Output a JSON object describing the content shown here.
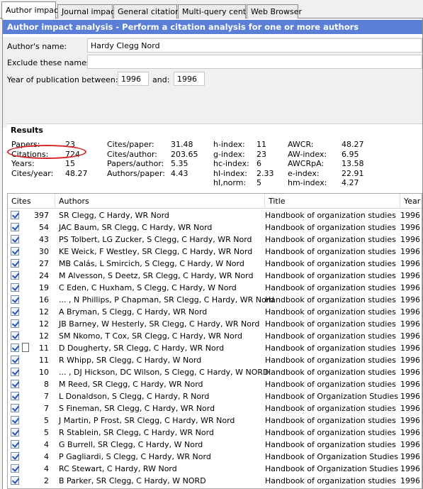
{
  "tabs": [
    "Author impact",
    "Journal impact",
    "General citations",
    "Multi-query center",
    "Web Browser"
  ],
  "header": "Author impact analysis - Perform a citation analysis for one or more authors",
  "form": {
    "author_label": "Author's name:",
    "author_value": "Hardy Clegg Nord",
    "exclude_label": "Exclude these names:",
    "exclude_value": "",
    "year_label": "Year of publication between:",
    "year_from": "1996",
    "and_label": "and:",
    "year_to": "1996"
  },
  "results": {
    "title": "Results",
    "col1": [
      [
        "Papers:",
        "23"
      ],
      [
        "Citations:",
        "724"
      ],
      [
        "Years:",
        "15"
      ],
      [
        "Cites/year:",
        "48.27"
      ]
    ],
    "col2": [
      [
        "Cites/paper:",
        "31.48"
      ],
      [
        "Cites/author:",
        "203.65"
      ],
      [
        "Papers/author:",
        "5.35"
      ],
      [
        "Authors/paper:",
        "4.43"
      ]
    ],
    "col3": [
      [
        "h-index:",
        "11"
      ],
      [
        "g-index:",
        "23"
      ],
      [
        "hc-index:",
        "6"
      ],
      [
        "hI-index:",
        "2.33"
      ],
      [
        "hI,norm:",
        "5"
      ]
    ],
    "col4": [
      [
        "AWCR:",
        "48.27"
      ],
      [
        "AW-index:",
        "6.95"
      ],
      [
        "AWCRpA:",
        "13.58"
      ],
      [
        "e-index:",
        "22.91"
      ],
      [
        "hm-index:",
        "4.27"
      ]
    ],
    "highlight_color": "#d4262b"
  },
  "table": {
    "headers": [
      "Cites",
      "Authors",
      "Title",
      "Year"
    ],
    "rows": [
      {
        "cites": "397",
        "authors": "SR Clegg, C Hardy, WR Nord",
        "title": "Handbook of organization studies",
        "year": "1996"
      },
      {
        "cites": "54",
        "authors": "JAC Baum, SR Clegg, C Hardy, WR Nord",
        "title": "Handbook of organization studies",
        "year": "1996"
      },
      {
        "cites": "43",
        "authors": "PS Tolbert, LG Zucker, S Clegg, C Hardy, WR Nord",
        "title": "Handbook of organization studies",
        "year": "1996"
      },
      {
        "cites": "30",
        "authors": "KE Weick, F Westley, SR Clegg, C Hardy, WR Nord",
        "title": "Handbook of organization studies",
        "year": "1996"
      },
      {
        "cites": "27",
        "authors": "MB Calás, L Smircich, S Clegg, C Hardy, W Nord",
        "title": "Handbook of organization studies",
        "year": "1996"
      },
      {
        "cites": "24",
        "authors": "M Alvesson, S Deetz, SR Clegg, C Hardy, WR Nord",
        "title": "Handbook of organization studies",
        "year": "1996"
      },
      {
        "cites": "19",
        "authors": "C Eden, C Huxham, S Clegg, C Hardy, W Nord",
        "title": "Handbook of organization studies",
        "year": "1996"
      },
      {
        "cites": "16",
        "authors": "... , N Phillips, P Chapman, SR Clegg, C Hardy, WR Nord",
        "title": "Handbook of organization studies",
        "year": "1996"
      },
      {
        "cites": "12",
        "authors": "A Bryman, S Clegg, C Hardy, WR Nord",
        "title": "Handbook of organization studies",
        "year": "1996"
      },
      {
        "cites": "12",
        "authors": "JB Barney, W Hesterly, SR Clegg, C Hardy, WR Nord",
        "title": "Handbook of organization studies",
        "year": "1996"
      },
      {
        "cites": "12",
        "authors": "SM Nkomo, T Cox, SR Clegg, C Hardy, WR Nord",
        "title": "Handbook of organization studies",
        "year": "1996"
      },
      {
        "cites": "11",
        "authors": "D Dougherty, SR Clegg, C Hardy, WR Nord",
        "title": "Handbook of organization studies",
        "year": "1996",
        "doc": true
      },
      {
        "cites": "11",
        "authors": "R Whipp, SR Clegg, C Hardy, W Nord",
        "title": "Handbook of organization studies",
        "year": "1996"
      },
      {
        "cites": "10",
        "authors": "... , DJ Hickson, DC Wilson, S Clegg, C Hardy, W NORD",
        "title": "Handbook of organization studies",
        "year": "1996"
      },
      {
        "cites": "8",
        "authors": "M Reed, SR Clegg, C Hardy, WR Nord",
        "title": "Handbook of organization studies",
        "year": "1996"
      },
      {
        "cites": "7",
        "authors": "L Donaldson, S Clegg, C Hardy, R Nord",
        "title": "Handbook of Organization Studies",
        "year": "1996"
      },
      {
        "cites": "7",
        "authors": "S Fineman, SR Clegg, C Hardy, WR Nord",
        "title": "Handbook of organization studies",
        "year": "1996"
      },
      {
        "cites": "5",
        "authors": "J Martin, P Frost, SR Clegg, C Hardy, WR Nord",
        "title": "Handbook of organization studies",
        "year": "1996"
      },
      {
        "cites": "5",
        "authors": "R Stablein, SR Clegg, C Hardy, WR Nord",
        "title": "Handbook of organization studies",
        "year": "1996"
      },
      {
        "cites": "4",
        "authors": "G Burrell, SR Clegg, C Hardy, W Nord",
        "title": "Handbook of organization studies",
        "year": "1996"
      },
      {
        "cites": "4",
        "authors": "P Gagliardi, S Clegg, C Hardy, WR Nord",
        "title": "Handbook of Organization Studies",
        "year": "1996"
      },
      {
        "cites": "4",
        "authors": "RC Stewart, C Hardy, RW Nord",
        "title": "Handbook of Organization Studies",
        "year": "1996"
      },
      {
        "cites": "2",
        "authors": "B Parker, SR Clegg, C Hardy, W NORD",
        "title": "Handbook of organization studies",
        "year": "1996"
      }
    ]
  }
}
